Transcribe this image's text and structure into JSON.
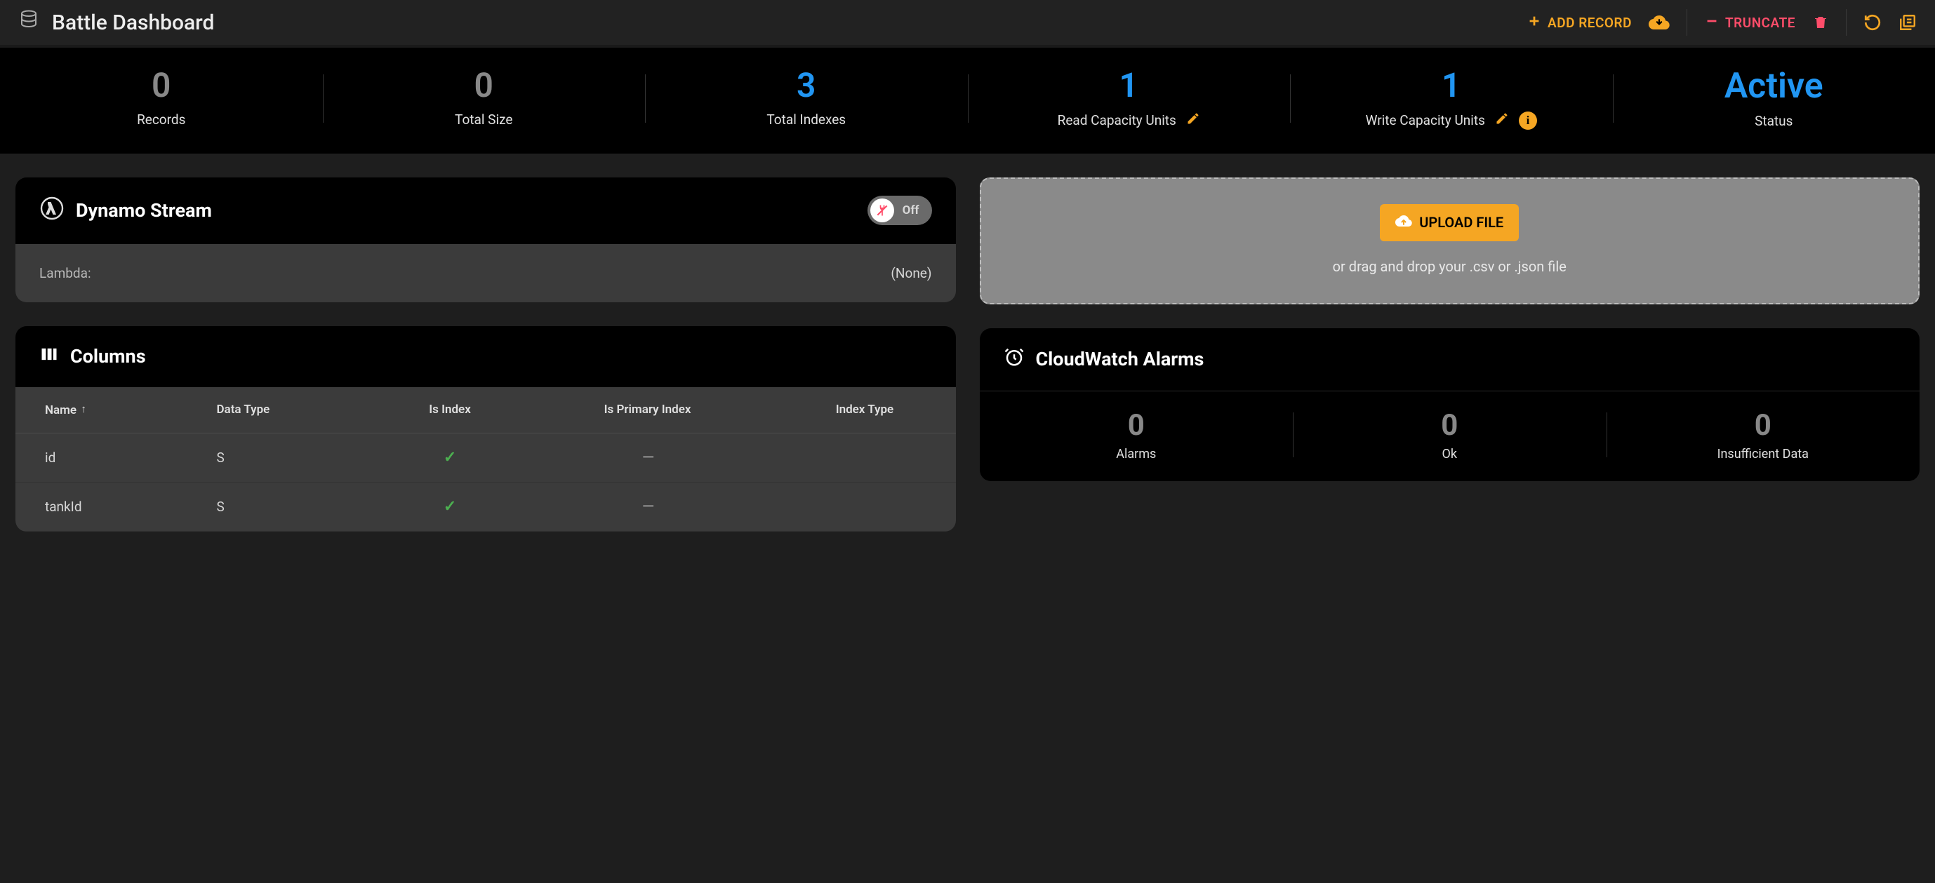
{
  "toolbar": {
    "title": "Battle Dashboard",
    "add_record": "ADD RECORD",
    "truncate": "TRUNCATE"
  },
  "stats": {
    "records": {
      "value": "0",
      "label": "Records"
    },
    "total_size": {
      "value": "0",
      "label": "Total Size"
    },
    "total_indexes": {
      "value": "3",
      "label": "Total Indexes"
    },
    "rcu": {
      "value": "1",
      "label": "Read Capacity Units"
    },
    "wcu": {
      "value": "1",
      "label": "Write Capacity Units"
    },
    "status": {
      "value": "Active",
      "label": "Status"
    }
  },
  "stream": {
    "title": "Dynamo Stream",
    "toggle_label": "Off",
    "lambda_label": "Lambda:",
    "lambda_value": "(None)"
  },
  "columns_card": {
    "title": "Columns",
    "headers": {
      "name": "Name",
      "data_type": "Data Type",
      "is_index": "Is Index",
      "is_primary": "Is Primary Index",
      "index_type": "Index Type"
    },
    "rows": [
      {
        "name": "id",
        "data_type": "S",
        "is_index": true,
        "is_primary": false,
        "index_type": ""
      },
      {
        "name": "tankId",
        "data_type": "S",
        "is_index": true,
        "is_primary": false,
        "index_type": ""
      }
    ]
  },
  "upload": {
    "button": "UPLOAD FILE",
    "hint": "or drag and drop your .csv or .json file"
  },
  "cloudwatch": {
    "title": "CloudWatch Alarms",
    "alarms": {
      "value": "0",
      "label": "Alarms"
    },
    "ok": {
      "value": "0",
      "label": "Ok"
    },
    "insufficient": {
      "value": "0",
      "label": "Insufficient Data"
    }
  }
}
